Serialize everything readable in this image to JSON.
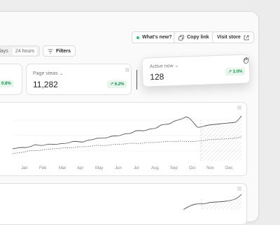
{
  "header": {
    "whats_new": "What's new?",
    "copy_link": "Copy link",
    "visit_store": "Visit store"
  },
  "toolbar": {
    "range_days": "days",
    "range_24h": "24 hours",
    "filters": "Filters"
  },
  "stats": {
    "partial_badge": "0.8%",
    "page_views": {
      "label": "Page views",
      "value": "11,282",
      "badge": "6.2%"
    },
    "active_now": {
      "label": "Active now",
      "value": "128",
      "badge": "2.0%"
    }
  },
  "chart": {
    "months": [
      "Jan",
      "Feb",
      "Mar",
      "Apr",
      "May",
      "Jun",
      "Jul",
      "Aug",
      "Sep",
      "Oct",
      "Nov",
      "Dec"
    ]
  },
  "colors": {
    "positive": "#1f8f50",
    "live_dot": "#2cbf6d"
  }
}
